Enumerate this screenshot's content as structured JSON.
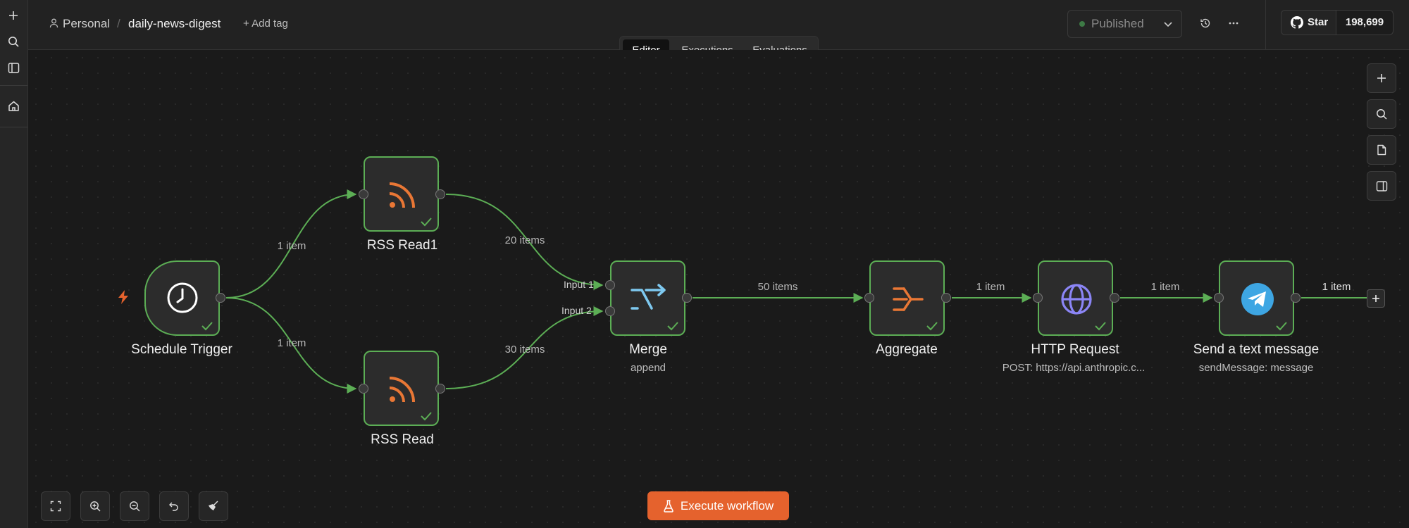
{
  "header": {
    "project": "Personal",
    "workflow_name": "daily-news-digest",
    "add_tag": "+ Add tag",
    "status_button": "Published",
    "github_star": "Star",
    "github_count": "198,699"
  },
  "tabs": [
    {
      "label": "Editor"
    },
    {
      "label": "Executions"
    },
    {
      "label": "Evaluations"
    }
  ],
  "nodes": {
    "schedule": {
      "label": "Schedule Trigger"
    },
    "rss1": {
      "label": "RSS Read1"
    },
    "rss": {
      "label": "RSS Read"
    },
    "merge": {
      "label": "Merge",
      "sub": "append"
    },
    "aggregate": {
      "label": "Aggregate"
    },
    "http": {
      "label": "HTTP Request",
      "sub": "POST: https://api.anthropic.c..."
    },
    "telegram": {
      "label": "Send a text message",
      "sub": "sendMessage: message"
    }
  },
  "edges": {
    "sched_rss1": "1 item",
    "sched_rss": "1 item",
    "rss1_merge": "20 items",
    "rss_merge": "30 items",
    "merge_agg": "50 items",
    "agg_http": "1 item",
    "http_tg": "1 item",
    "tg_out": "1 item"
  },
  "merge_inputs": {
    "input1": "Input 1",
    "input2": "Input 2"
  },
  "execute_button": "Execute workflow",
  "colors": {
    "accent": "#e5622d",
    "success": "#5cae55",
    "http_icon": "#8b85f5",
    "telegram": "#3ea6e3"
  }
}
